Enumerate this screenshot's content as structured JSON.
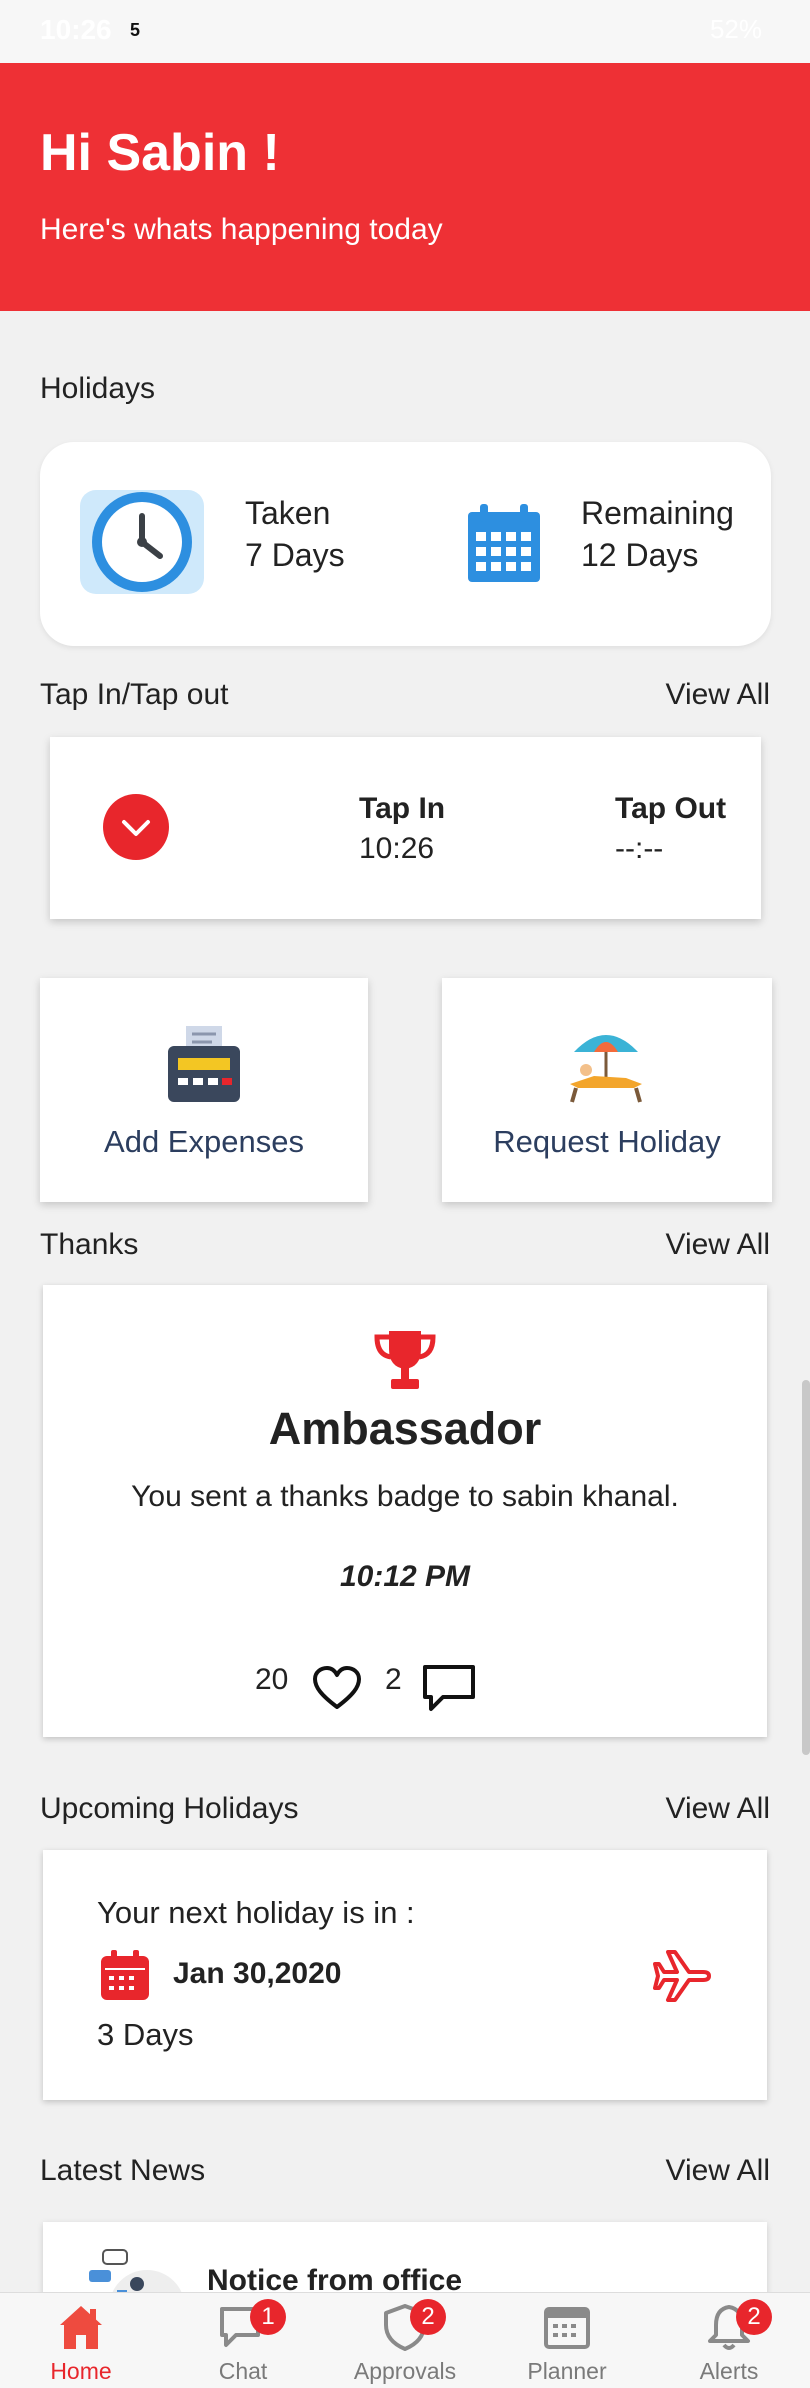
{
  "status_bar": {
    "time": "10:26",
    "notification_count": "5",
    "battery": "52%"
  },
  "header": {
    "greeting": "Hi Sabin !",
    "subtitle": "Here's whats happening today"
  },
  "holidays": {
    "title": "Holidays",
    "taken_label": "Taken",
    "taken_value": "7 Days",
    "remaining_label": "Remaining",
    "remaining_value": "12 Days"
  },
  "tap": {
    "title": "Tap In/Tap out",
    "view_all": "View All",
    "tap_in_label": "Tap In",
    "tap_in_value": "10:26",
    "tap_out_label": "Tap Out",
    "tap_out_value": "--:--"
  },
  "actions": {
    "add_expenses": "Add Expenses",
    "request_holiday": "Request Holiday"
  },
  "thanks": {
    "title": "Thanks",
    "view_all": "View All",
    "badge": "Ambassador",
    "message": "You sent a thanks badge to sabin khanal.",
    "time": "10:12 PM",
    "likes": "20",
    "comments": "2"
  },
  "upcoming": {
    "title": "Upcoming Holidays",
    "view_all": "View All",
    "line": "Your next holiday is in :",
    "date": "Jan 30,2020",
    "days": "3 Days"
  },
  "news": {
    "title": "Latest News",
    "view_all": "View All",
    "item_title": "Notice from office"
  },
  "nav": {
    "items": [
      {
        "label": "Home",
        "badge": ""
      },
      {
        "label": "Chat",
        "badge": "1"
      },
      {
        "label": "Approvals",
        "badge": "2"
      },
      {
        "label": "Planner",
        "badge": ""
      },
      {
        "label": "Alerts",
        "badge": "2"
      }
    ]
  },
  "colors": {
    "accent": "#ee3035",
    "action_text": "#2c3e5f",
    "clock_blue": "#2d8fe0"
  }
}
